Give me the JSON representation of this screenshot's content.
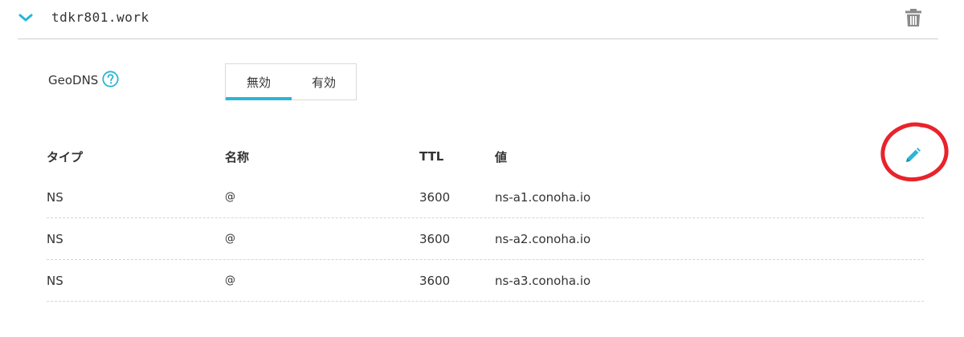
{
  "header": {
    "domain": "tdkr801.work"
  },
  "geodns": {
    "label": "GeoDNS",
    "options": [
      "無効",
      "有効"
    ],
    "selected": "無効"
  },
  "table": {
    "columns": [
      "タイプ",
      "名称",
      "TTL",
      "値"
    ],
    "rows": [
      [
        "NS",
        "@",
        "3600",
        "ns-a1.conoha.io"
      ],
      [
        "NS",
        "@",
        "3600",
        "ns-a2.conoha.io"
      ],
      [
        "NS",
        "@",
        "3600",
        "ns-a3.conoha.io"
      ]
    ]
  },
  "icons": {
    "collapse": "chevron-down-icon",
    "delete": "trash-icon",
    "help": "question-circle-icon",
    "edit": "pencil-icon"
  },
  "colors": {
    "accent": "#2bb5d6",
    "annotation": "#e8232b",
    "icon_gray": "#8a8a8a"
  }
}
